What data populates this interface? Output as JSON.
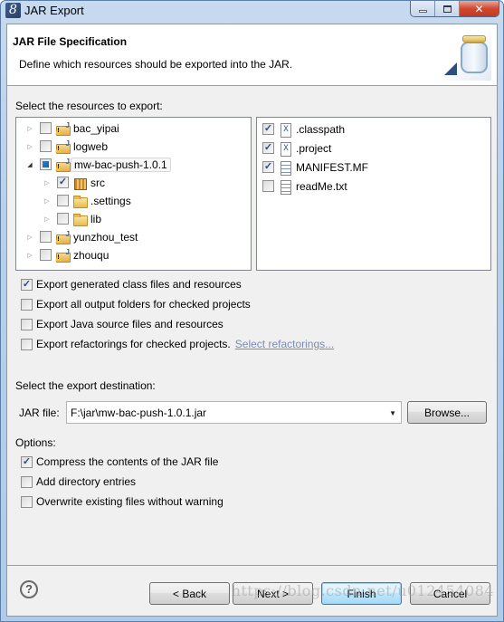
{
  "window": {
    "title": "JAR Export",
    "controls": {
      "minimize": "minimize",
      "maximize": "maximize",
      "close": "close"
    }
  },
  "header": {
    "title": "JAR File Specification",
    "description": "Define which resources should be exported into the JAR."
  },
  "resources": {
    "label": "Select the resources to export:",
    "tree": [
      {
        "label": "bac_yipai",
        "icon": "java-project-warning-icon",
        "state": "unchecked",
        "expanded": false,
        "level": 0
      },
      {
        "label": "logweb",
        "icon": "java-project-warning-icon",
        "state": "unchecked",
        "expanded": false,
        "level": 0
      },
      {
        "label": "mw-bac-push-1.0.1",
        "icon": "java-project-warning-icon",
        "state": "partial",
        "expanded": true,
        "level": 0,
        "selected": true
      },
      {
        "label": "src",
        "icon": "package-folder-warning-icon",
        "state": "checked",
        "expanded": false,
        "level": 1
      },
      {
        "label": ".settings",
        "icon": "folder-icon",
        "state": "unchecked",
        "expanded": false,
        "level": 1
      },
      {
        "label": "lib",
        "icon": "folder-icon",
        "state": "unchecked",
        "expanded": false,
        "level": 1
      },
      {
        "label": "yunzhou_test",
        "icon": "java-project-warning-icon",
        "state": "unchecked",
        "expanded": false,
        "level": 0
      },
      {
        "label": "zhouqu",
        "icon": "java-project-warning-icon",
        "state": "unchecked",
        "expanded": false,
        "level": 0
      }
    ],
    "files": [
      {
        "label": ".classpath",
        "icon": "xml-file-icon",
        "checked": true
      },
      {
        "label": ".project",
        "icon": "xml-file-icon",
        "checked": true
      },
      {
        "label": "MANIFEST.MF",
        "icon": "text-file-icon",
        "checked": true
      },
      {
        "label": "readMe.txt",
        "icon": "text-file-icon",
        "checked": false
      }
    ]
  },
  "export_options": [
    {
      "label": "Export generated class files and resources",
      "checked": true
    },
    {
      "label": "Export all output folders for checked projects",
      "checked": false
    },
    {
      "label": "Export Java source files and resources",
      "checked": false
    },
    {
      "label": "Export refactorings for checked projects.",
      "checked": false,
      "link": "Select refactorings..."
    }
  ],
  "destination": {
    "label": "Select the export destination:",
    "jar_label": "JAR file:",
    "jar_value": "F:\\jar\\mw-bac-push-1.0.1.jar",
    "browse_label": "Browse..."
  },
  "options": {
    "label": "Options:",
    "items": [
      {
        "label": "Compress the contents of the JAR file",
        "checked": true
      },
      {
        "label": "Add directory entries",
        "checked": false
      },
      {
        "label": "Overwrite existing files without warning",
        "checked": false
      }
    ]
  },
  "footer": {
    "back": "< Back",
    "next": "Next >",
    "finish": "Finish",
    "cancel": "Cancel",
    "help_glyph": "?"
  },
  "watermark": "https://blog.csdn.net/u012454084"
}
